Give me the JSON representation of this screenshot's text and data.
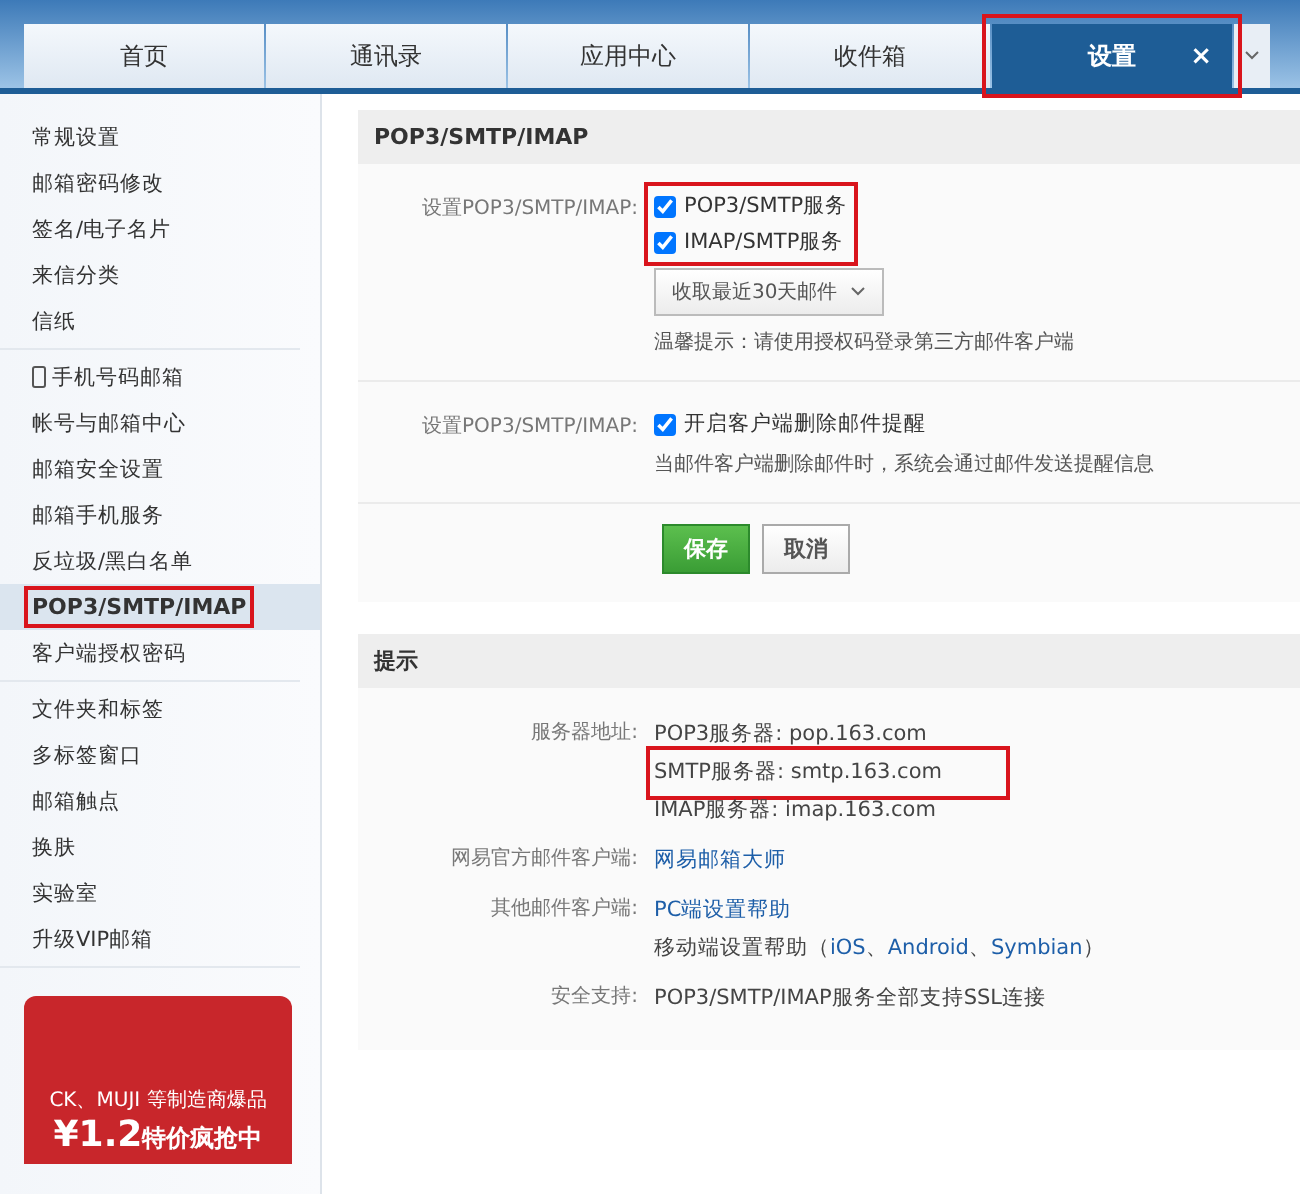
{
  "tabs": [
    {
      "label": "首页",
      "selected": false,
      "highlighted": false
    },
    {
      "label": "通讯录",
      "selected": false,
      "highlighted": false
    },
    {
      "label": "应用中心",
      "selected": false,
      "highlighted": false
    },
    {
      "label": "收件箱",
      "selected": false,
      "highlighted": false
    },
    {
      "label": "设置",
      "selected": true,
      "highlighted": true,
      "close": "×"
    }
  ],
  "sidebar": {
    "groups": [
      {
        "items": [
          {
            "label": "常规设置",
            "selected": false,
            "highlighted": false,
            "phone": false
          },
          {
            "label": "邮箱密码修改",
            "selected": false,
            "highlighted": false,
            "phone": false
          },
          {
            "label": "签名/电子名片",
            "selected": false,
            "highlighted": false,
            "phone": false
          },
          {
            "label": "来信分类",
            "selected": false,
            "highlighted": false,
            "phone": false
          },
          {
            "label": "信纸",
            "selected": false,
            "highlighted": false,
            "phone": false
          }
        ]
      },
      {
        "items": [
          {
            "label": "手机号码邮箱",
            "selected": false,
            "highlighted": false,
            "phone": true
          },
          {
            "label": "帐号与邮箱中心",
            "selected": false,
            "highlighted": false,
            "phone": false
          },
          {
            "label": "邮箱安全设置",
            "selected": false,
            "highlighted": false,
            "phone": false
          },
          {
            "label": "邮箱手机服务",
            "selected": false,
            "highlighted": false,
            "phone": false
          },
          {
            "label": "反垃圾/黑白名单",
            "selected": false,
            "highlighted": false,
            "phone": false
          },
          {
            "label": "POP3/SMTP/IMAP",
            "selected": true,
            "highlighted": true,
            "phone": false
          },
          {
            "label": "客户端授权密码",
            "selected": false,
            "highlighted": false,
            "phone": false
          }
        ]
      },
      {
        "items": [
          {
            "label": "文件夹和标签",
            "selected": false,
            "highlighted": false,
            "phone": false
          },
          {
            "label": "多标签窗口",
            "selected": false,
            "highlighted": false,
            "phone": false
          },
          {
            "label": "邮箱触点",
            "selected": false,
            "highlighted": false,
            "phone": false
          },
          {
            "label": "换肤",
            "selected": false,
            "highlighted": false,
            "phone": false
          },
          {
            "label": "实验室",
            "selected": false,
            "highlighted": false,
            "phone": false
          },
          {
            "label": "升级VIP邮箱",
            "selected": false,
            "highlighted": false,
            "phone": false
          }
        ]
      }
    ],
    "ad": {
      "line_1": "CK、MUJI 等制造商爆品",
      "price": "¥1.2",
      "line_2": "特价疯抢中"
    }
  },
  "settings_panel": {
    "title": "POP3/SMTP/IMAP",
    "section_1": {
      "label": "设置POP3/SMTP/IMAP:",
      "highlighted": true,
      "options": [
        {
          "label": "POP3/SMTP服务",
          "checked": true
        },
        {
          "label": "IMAP/SMTP服务",
          "checked": true
        }
      ],
      "dropdown": "收取最近30天邮件",
      "hint": "温馨提示：请使用授权码登录第三方邮件客户端"
    },
    "section_2": {
      "label": "设置POP3/SMTP/IMAP:",
      "option": {
        "label": "开启客户端删除邮件提醒",
        "checked": true
      },
      "note": "当邮件客户端删除邮件时，系统会通过邮件发送提醒信息"
    },
    "buttons": {
      "save": "保存",
      "cancel": "取消"
    }
  },
  "tips_panel": {
    "title": "提示",
    "rows": [
      {
        "label": "服务器地址:",
        "lines": [
          {
            "kind": "text",
            "text": "POP3服务器: pop.163.com",
            "highlighted": false
          },
          {
            "kind": "text",
            "text": "SMTP服务器: smtp.163.com",
            "highlighted": true
          },
          {
            "kind": "text",
            "text": "IMAP服务器: imap.163.com",
            "highlighted": false
          }
        ]
      },
      {
        "label": "网易官方邮件客户端:",
        "lines": [
          {
            "kind": "link",
            "text": "网易邮箱大师",
            "highlighted": false
          }
        ]
      },
      {
        "label": "其他邮件客户端:",
        "lines": [
          {
            "kind": "link",
            "text": "PC端设置帮助",
            "highlighted": false
          },
          {
            "kind": "mobile",
            "text": "移动端设置帮助（",
            "links": [
              "iOS",
              "Android",
              "Symbian"
            ],
            "sep": "、",
            "end": "）",
            "highlighted": false
          }
        ]
      },
      {
        "label": "安全支持:",
        "lines": [
          {
            "kind": "text",
            "text": "POP3/SMTP/IMAP服务全部支持SSL连接",
            "highlighted": false
          }
        ]
      }
    ]
  }
}
